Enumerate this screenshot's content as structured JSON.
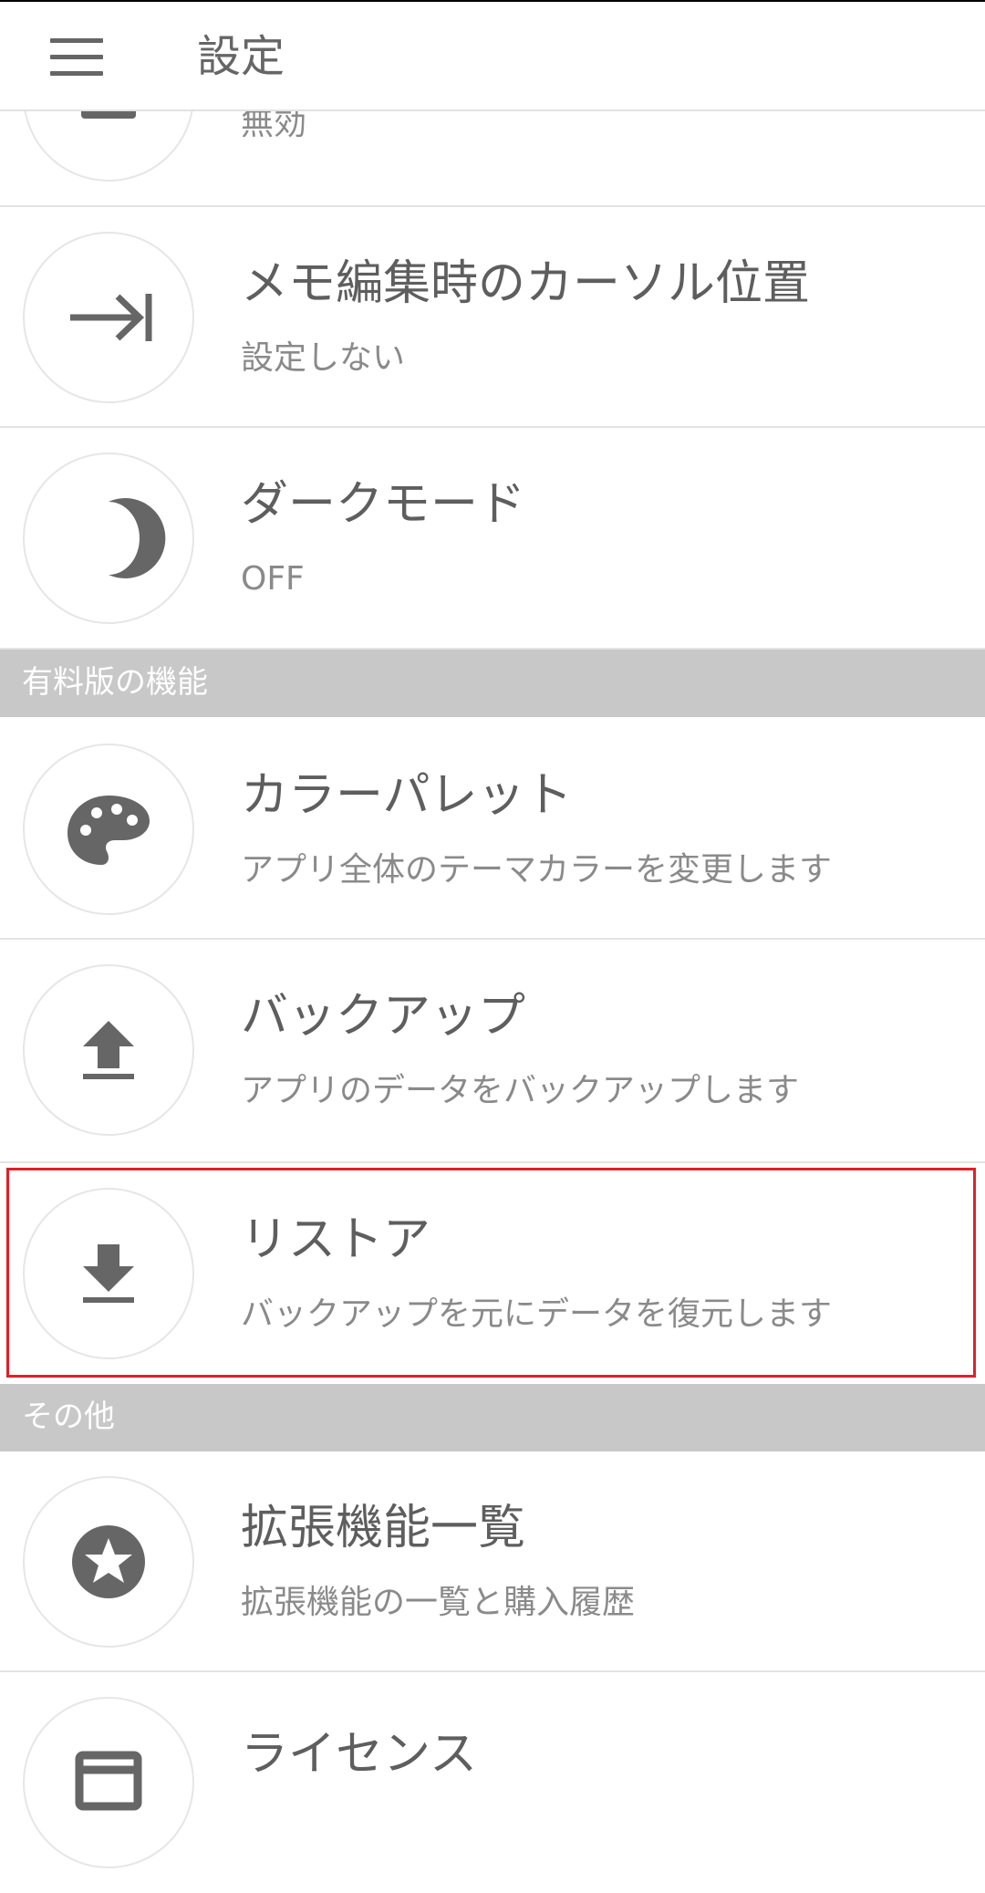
{
  "app_bar": {
    "title": "設定",
    "menu_icon": "hamburger-menu-icon"
  },
  "rows": {
    "partial_top": {
      "subtitle": "無効",
      "icon": "partial-icon"
    },
    "cursor_position": {
      "title": "メモ編集時のカーソル位置",
      "subtitle": "設定しない",
      "icon": "arrow-to-end-icon"
    },
    "dark_mode": {
      "title": "ダークモード",
      "subtitle": "OFF",
      "icon": "moon-icon"
    },
    "color_palette": {
      "title": "カラーパレット",
      "subtitle": "アプリ全体のテーマカラーを変更します",
      "icon": "palette-icon"
    },
    "backup": {
      "title": "バックアップ",
      "subtitle": "アプリのデータをバックアップします",
      "icon": "upload-icon"
    },
    "restore": {
      "title": "リストア",
      "subtitle": "バックアップを元にデータを復元します",
      "icon": "download-icon"
    },
    "extensions": {
      "title": "拡張機能一覧",
      "subtitle": "拡張機能の一覧と購入履歴",
      "icon": "star-icon"
    },
    "license": {
      "title": "ライセンス",
      "icon": "license-icon"
    }
  },
  "sections": {
    "paid_features": "有料版の機能",
    "other": "その他"
  },
  "colors": {
    "highlight_border": "#e0202a",
    "section_bg": "#c8c8c8",
    "icon": "#666666"
  }
}
